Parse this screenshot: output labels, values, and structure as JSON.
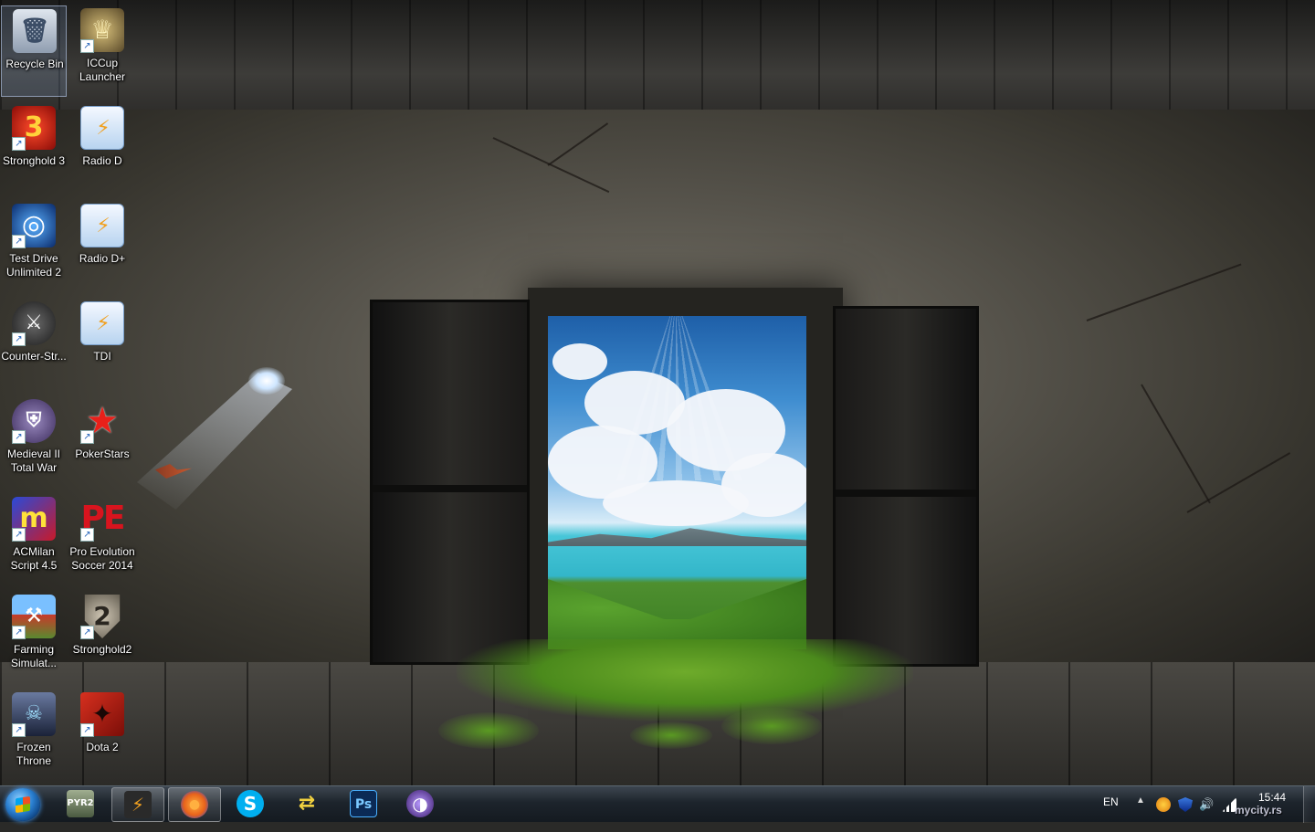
{
  "desktop": {
    "icons": [
      {
        "label": "Recycle Bin",
        "icon": "recycle-bin-icon",
        "color": "#9aa7b8"
      },
      {
        "label": "ICCup\nLauncher",
        "icon": "iccup-launcher-icon",
        "color": "#8a7a4a"
      },
      {
        "label": "Stronghold 3",
        "icon": "stronghold3-icon",
        "color": "#c8201c"
      },
      {
        "label": "Radio D",
        "icon": "radio-d-icon",
        "color": "#3d8ed8"
      },
      {
        "label": "Test Drive\nUnlimited 2",
        "icon": "test-drive-icon",
        "color": "#1a5fb0"
      },
      {
        "label": "Radio D+",
        "icon": "radio-d-plus-icon",
        "color": "#3d8ed8"
      },
      {
        "label": "Counter-Str...",
        "icon": "counter-strike-icon",
        "color": "#444"
      },
      {
        "label": "TDI",
        "icon": "tdi-icon",
        "color": "#3d8ed8"
      },
      {
        "label": "Medieval II\nTotal War",
        "icon": "medieval-total-war-icon",
        "color": "#5a4a7a"
      },
      {
        "label": "PokerStars",
        "icon": "pokerstars-icon",
        "color": "#d41f1f"
      },
      {
        "label": "ACMilan\nScript 4.5",
        "icon": "acmilan-script-icon",
        "color": "#2040c0"
      },
      {
        "label": "Pro Evolution\nSoccer 2014",
        "icon": "pes-2014-icon",
        "color": "#c8101a"
      },
      {
        "label": "Farming\nSimulat...",
        "icon": "farming-simulator-icon",
        "color": "#3a7a30"
      },
      {
        "label": "Stronghold2",
        "icon": "stronghold2-icon",
        "color": "#8a8478"
      },
      {
        "label": "Frozen\nThrone",
        "icon": "frozen-throne-icon",
        "color": "#3a4a6a"
      },
      {
        "label": "Dota 2",
        "icon": "dota2-icon",
        "color": "#b0261a"
      }
    ],
    "glyphs": {
      "recycle": "🗑",
      "stronghold3": "3",
      "radio": "⚡",
      "pokerstars": "★",
      "acmilan": "m",
      "pes": "PE",
      "stronghold2": "2",
      "dota": "✦",
      "counter": "⚔",
      "iccup": "♕",
      "medieval": "⛨",
      "testdrive": "◎",
      "farming": "⚒",
      "frozen": "☠"
    }
  },
  "taskbar": {
    "start_label": "Start",
    "pinned": [
      {
        "name": "pyr2-app-icon",
        "label": "PYR2",
        "color": "#7a8a70"
      },
      {
        "name": "winamp-icon",
        "label": "⚡",
        "color": "#3a3a3a",
        "active": true
      },
      {
        "name": "firefox-icon",
        "label": "●",
        "color": "#e86a10"
      },
      {
        "name": "skype-icon",
        "label": "S",
        "color": "#00aff0"
      },
      {
        "name": "network-tool-icon",
        "label": "⇄",
        "color": "#3a6ab0"
      },
      {
        "name": "photoshop-icon",
        "label": "Ps",
        "color": "#0b2a55"
      },
      {
        "name": "eclipse-icon",
        "label": "◑",
        "color": "#4a2a7a"
      }
    ],
    "tray": {
      "language": "EN",
      "show_hidden": "▲",
      "clock_time": "15:44",
      "watermark": "mycity.rs"
    }
  },
  "colors": {
    "taskbar": "#1d242c",
    "selection": "#8caadc"
  }
}
